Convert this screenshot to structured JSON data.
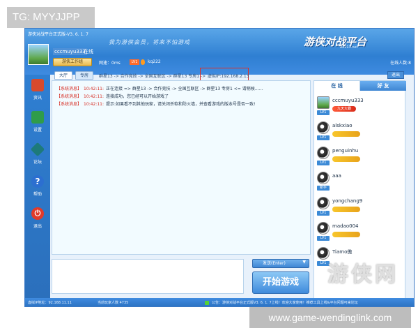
{
  "overlays": {
    "tag": "TG: MYYJJPP",
    "url": "www.game-wendinglink.com",
    "logo_text": "游侠网"
  },
  "window": {
    "title": "游侠对战平台正式版-V3. 6. 1. 7",
    "slogan": "我为游侠会员，将来不怕游戏",
    "brand_logo": "游侠对战平台",
    "brand_sub": "Ali213.net"
  },
  "user": {
    "name": "cccmuyu333",
    "status": "在线",
    "workshop": "游侠工作组",
    "latency_label": "网速：0ms",
    "level": "LV1",
    "room": "kq222",
    "online_count_label": "在线人数:8"
  },
  "sidebar": {
    "items": [
      {
        "label": "资讯",
        "icon": "news-icon",
        "color": "#d84a2c"
      },
      {
        "label": "设置",
        "icon": "settings-icon",
        "color": "#2f9c4a"
      },
      {
        "label": "论坛",
        "icon": "forum-icon",
        "color": "#1d7a7a"
      },
      {
        "label": "帮助",
        "icon": "help-icon",
        "color": "#2c6fd0"
      },
      {
        "label": "退出",
        "icon": "power-icon",
        "color": "#e23a2a"
      }
    ]
  },
  "tabs": {
    "hall": "大厅",
    "room": "专房",
    "route": "群星13 -> 合作竞技 -> 全国互联区 -> 群星13 专房1 ->",
    "vip": "虚拟IP:192.168.2.13",
    "exit": "退出"
  },
  "chat": {
    "lines": [
      {
        "tag": "【系统消息】",
        "time": "10:42:11:",
        "text": "正在连接 => 群星13 -> 合作竞技 -> 全国互联区 -> 群星13 专房1 <= 请稍候……"
      },
      {
        "tag": "【系统消息】",
        "time": "10:42:11:",
        "text": "连接成功，您已经可以开始游戏了"
      },
      {
        "tag": "【系统消息】",
        "time": "10:42:11:",
        "text": "提示:如果看不到其他玩家，请关闭杀软和防火墙，并查看游戏的版本号是否一致!"
      }
    ]
  },
  "actions": {
    "send": "发送(Enter)",
    "start": "开始游戏"
  },
  "friends": {
    "tab_online": "在 线",
    "tab_friends": "好 友",
    "users": [
      {
        "name": "cccmuyu333",
        "level": "LV1",
        "badge": "九天大霸",
        "self": true
      },
      {
        "name": "alskxiao",
        "level": "LV1",
        "badge": "",
        "self": false
      },
      {
        "name": "penguinhu",
        "level": "LV1",
        "badge": "",
        "self": false
      },
      {
        "name": "aaa",
        "level": "新手",
        "badge": "",
        "self": false
      },
      {
        "name": "yongchang9",
        "level": "LV1",
        "badge": "",
        "self": false
      },
      {
        "name": "madao004",
        "level": "LV1",
        "badge": "",
        "self": false
      },
      {
        "name": "Tiamo傲",
        "level": "LV1",
        "badge": "",
        "self": false
      }
    ]
  },
  "statusbar": {
    "left": "虚拟IP地址：92.168.11.11",
    "middle": "当前玩家人数 4735",
    "right": "公告：游侠对战平台正式版V3. 6. 1. 7上线！欢迎大家使用！推荐工具上线&平台问题可来论坛"
  }
}
